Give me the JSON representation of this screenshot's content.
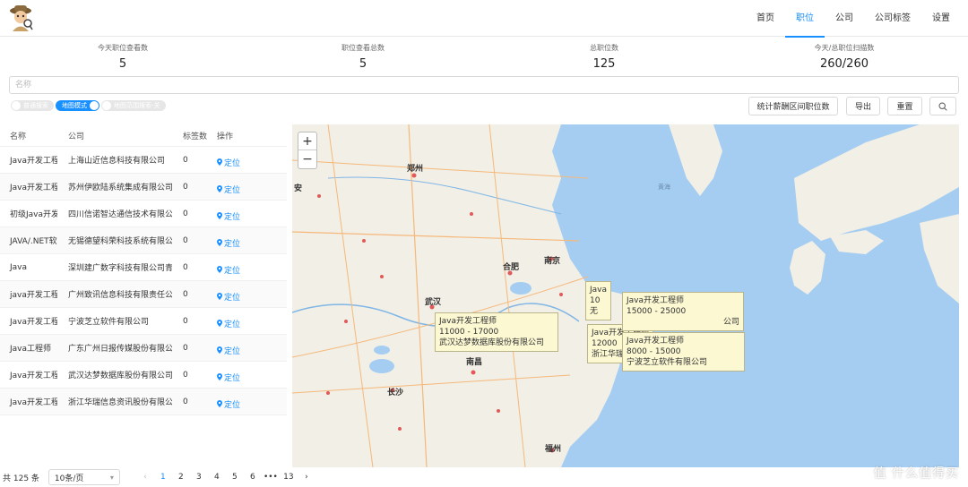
{
  "header": {
    "nav": [
      "首页",
      "职位",
      "公司",
      "公司标签",
      "设置"
    ],
    "active_index": 1,
    "accent": "#1890ff"
  },
  "stats": [
    {
      "label": "今天职位查看数",
      "value": "5"
    },
    {
      "label": "职位查看总数",
      "value": "5"
    },
    {
      "label": "总职位数",
      "value": "125"
    },
    {
      "label": "今天/总职位扫描数",
      "value": "260/260"
    }
  ],
  "search": {
    "placeholder": "名称",
    "value": ""
  },
  "toggles": [
    {
      "label": "普通搜索",
      "on": false
    },
    {
      "label": "地图模式",
      "on": true
    },
    {
      "label": "地图范围搜索-关",
      "on": false
    }
  ],
  "buttons": {
    "stats_salary": "统计薪酬区间职位数",
    "export": "导出",
    "reset": "重置",
    "search_icon": "search-icon"
  },
  "table": {
    "headers": [
      "名称",
      "公司",
      "标签数",
      "操作"
    ],
    "action_label": "定位",
    "rows": [
      {
        "name": "Java开发工程",
        "company": "上海山近信息科技有限公司",
        "tags": "0"
      },
      {
        "name": "Java开发工程",
        "company": "苏州伊欧陆系统集成有限公司",
        "tags": "0"
      },
      {
        "name": "初级Java开发",
        "company": "四川信诺智达通信技术有限公司",
        "tags": "0"
      },
      {
        "name": "JAVA/.NET软",
        "company": "无锡德望科荣科技系统有限公司",
        "tags": "0"
      },
      {
        "name": "Java",
        "company": "深圳建广数字科技有限公司青岛",
        "tags": "0"
      },
      {
        "name": "java开发工程",
        "company": "广州致讯信息科技有限责任公司",
        "tags": "0"
      },
      {
        "name": "Java开发工程",
        "company": "宁波芝立软件有限公司",
        "tags": "0"
      },
      {
        "name": "Java工程师",
        "company": "广东广州日报传媒股份有限公司",
        "tags": "0"
      },
      {
        "name": "Java开发工程",
        "company": "武汉达梦数据库股份有限公司",
        "tags": "0"
      },
      {
        "name": "Java开发工程",
        "company": "浙江华瑞信息资讯股份有限公司",
        "tags": "0"
      }
    ]
  },
  "map": {
    "zoom_in": "+",
    "zoom_out": "−",
    "city_labels": [
      "郑州",
      "合肥",
      "南京",
      "武汉",
      "南昌",
      "长沙",
      "福州",
      "黄海",
      "安"
    ],
    "popups": [
      {
        "title": "Java开发工程师",
        "salary": "11000 - 17000",
        "company": "武汉达梦数据库股份有限公司"
      },
      {
        "title": "Java开发工程师",
        "salary": "15000 - 25000",
        "company": "公司"
      },
      {
        "title": "Java开发工程师",
        "salary": "8000 - 15000",
        "company": "宁波芝立软件有限公司"
      },
      {
        "title": "Java开发工程师",
        "salary": "12000",
        "company": "浙江华瑞"
      },
      {
        "title": "Java",
        "salary": "10",
        "company": "无"
      }
    ],
    "sea_color": "#a5cdf1",
    "land_color": "#f2efe6"
  },
  "footer": {
    "total": "共 125 条",
    "page_size": "10条/页",
    "pages": [
      "1",
      "2",
      "3",
      "4",
      "5",
      "6",
      "•••",
      "13"
    ],
    "current_page": "1",
    "prev": "‹",
    "next": "›"
  },
  "watermark": "值 什么值得买"
}
